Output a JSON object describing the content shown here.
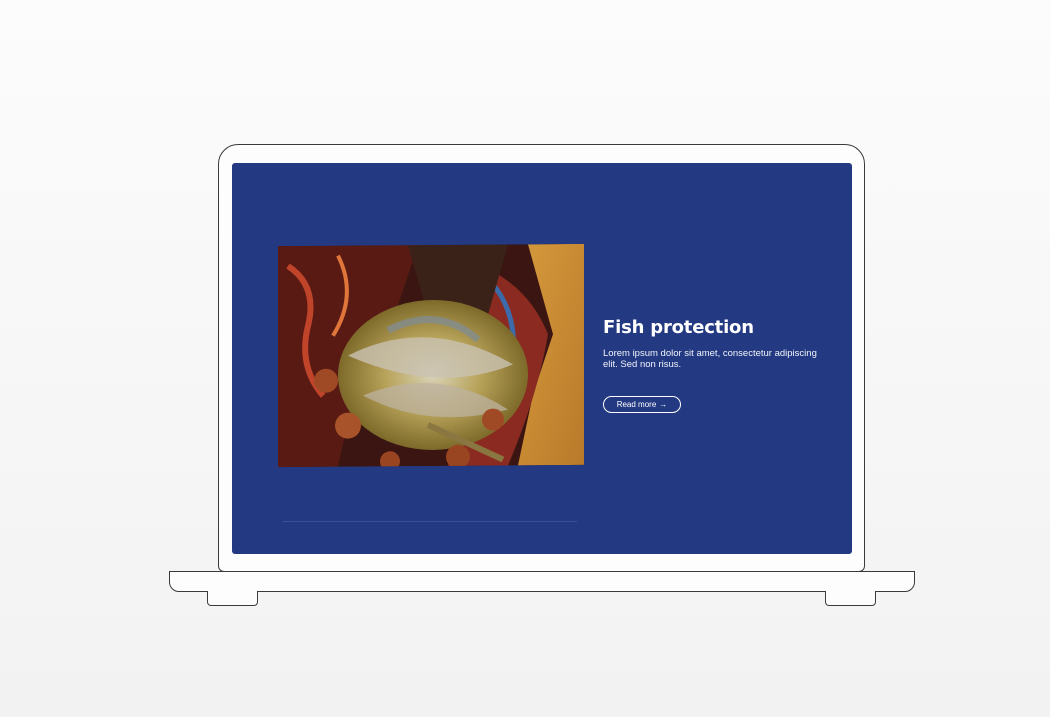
{
  "card": {
    "title": "Fish protection",
    "description": "Lorem ipsum dolor sit amet, consectetur adipiscing elit. Sed non risus.",
    "read_more_label": "Read more",
    "read_more_arrow": "→"
  },
  "colors": {
    "screen_background": "#233982",
    "text": "#ffffff"
  }
}
